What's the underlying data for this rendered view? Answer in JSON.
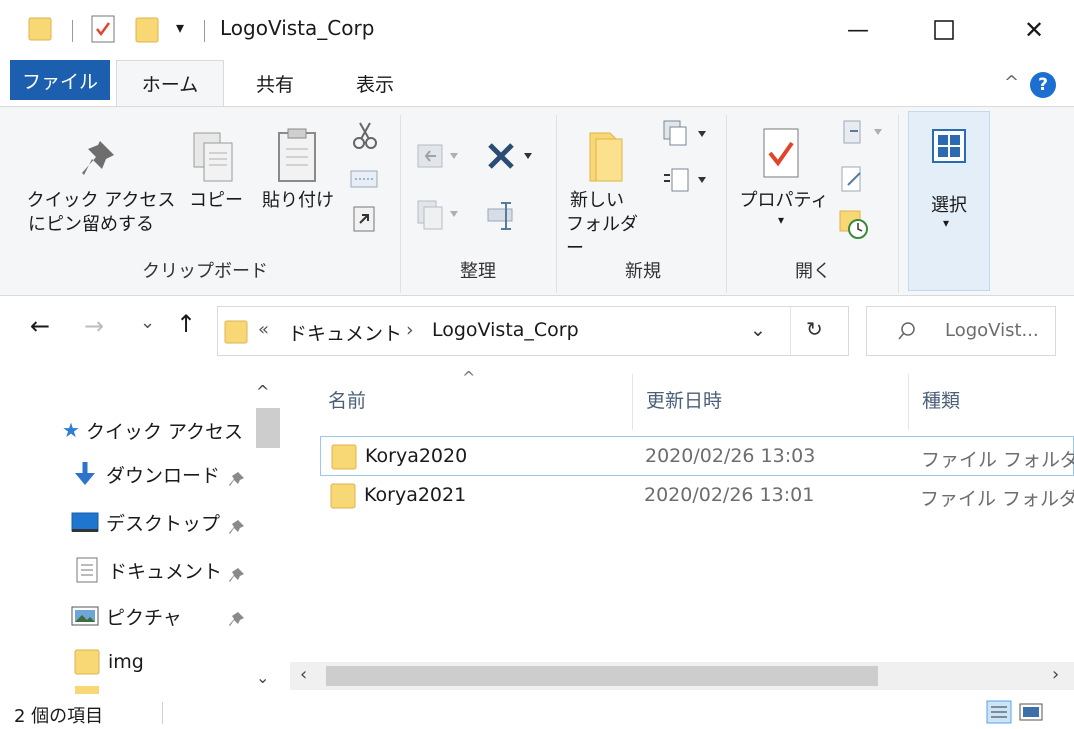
{
  "window": {
    "title": "LogoVista_Corp",
    "minimize_glyph": "—",
    "maximize_glyph": "☐",
    "close_glyph": "✕"
  },
  "quick_access_toolbar": {
    "dropdown_glyph": "▾"
  },
  "ribbon": {
    "tabs": [
      {
        "label": "ファイル"
      },
      {
        "label": "ホーム"
      },
      {
        "label": "共有"
      },
      {
        "label": "表示"
      }
    ],
    "collapse_glyph": "^",
    "help_glyph": "?",
    "groups": {
      "clipboard": {
        "label": "クリップボード",
        "pin_label_line1": "クイック アクセス",
        "pin_label_line2": "にピン留めする",
        "copy_label": "コピー",
        "paste_label": "貼り付け"
      },
      "organize": {
        "label": "整理"
      },
      "new": {
        "label": "新規",
        "new_folder_line1": "新しい",
        "new_folder_line2": "フォルダー"
      },
      "open": {
        "label": "開く",
        "properties_label": "プロパティ"
      },
      "select": {
        "label": "選択"
      }
    }
  },
  "navigation": {
    "back_glyph": "←",
    "forward_glyph": "→",
    "recent_glyph": "⌄",
    "up_glyph": "↑",
    "breadcrumb_overflow": "«",
    "breadcrumb": [
      "ドキュメント",
      "LogoVista_Corp"
    ],
    "breadcrumb_separator": "›",
    "address_dropdown_glyph": "⌄",
    "refresh_glyph": "↻",
    "search_placeholder": "LogoVist..."
  },
  "nav_pane": {
    "items": [
      {
        "label": "クイック アクセス",
        "icon": "star-icon"
      },
      {
        "label": "ダウンロード",
        "icon": "download-icon",
        "pinned": true
      },
      {
        "label": "デスクトップ",
        "icon": "desktop-icon",
        "pinned": true
      },
      {
        "label": "ドキュメント",
        "icon": "document-icon",
        "pinned": true
      },
      {
        "label": "ピクチャ",
        "icon": "picture-icon",
        "pinned": true
      },
      {
        "label": "img",
        "icon": "folder-icon"
      }
    ],
    "pin_glyph": "📌"
  },
  "file_list": {
    "sort_glyph": "^",
    "columns": [
      "名前",
      "更新日時",
      "種類"
    ],
    "rows": [
      {
        "name": "Korya2020",
        "modified": "2020/02/26 13:03",
        "type": "ファイル フォルダー"
      },
      {
        "name": "Korya2021",
        "modified": "2020/02/26 13:01",
        "type": "ファイル フォルダー"
      }
    ]
  },
  "status_bar": {
    "item_count": "2 個の項目"
  },
  "colors": {
    "accent": "#1c5fae",
    "folder": "#f8d775",
    "selection_border": "#99c9ef"
  }
}
